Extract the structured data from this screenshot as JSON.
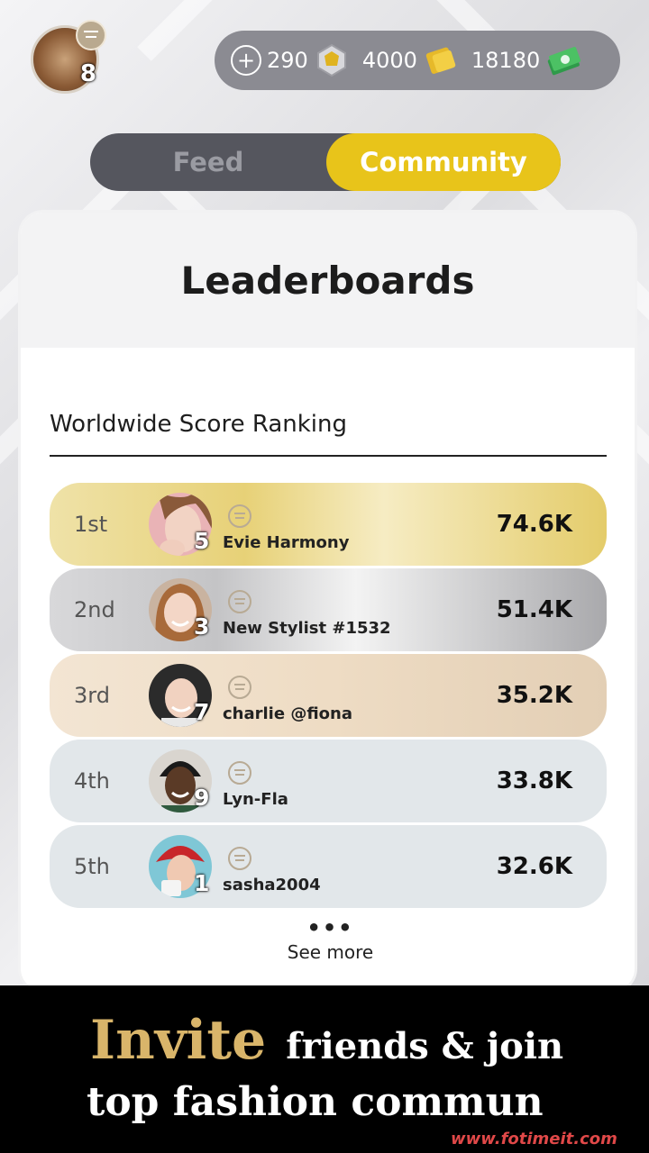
{
  "header": {
    "player_level": "8",
    "currencies": [
      {
        "icon": "gem-coin-icon",
        "value": "290"
      },
      {
        "icon": "gold-ticket-icon",
        "value": "4000"
      },
      {
        "icon": "cash-stack-icon",
        "value": "18180"
      }
    ],
    "add_symbol": "+"
  },
  "tabs": [
    {
      "label": "Feed",
      "active": false
    },
    {
      "label": "Community",
      "active": true
    }
  ],
  "card": {
    "title": "Leaderboards",
    "section_title": "Worldwide Score Ranking",
    "rows": [
      {
        "rank": "1st",
        "level": "5",
        "name": "Evie Harmony",
        "score": "74.6K"
      },
      {
        "rank": "2nd",
        "level": "3",
        "name": "New Stylist #1532",
        "score": "51.4K"
      },
      {
        "rank": "3rd",
        "level": "7",
        "name": "charlie @fiona",
        "score": "35.2K"
      },
      {
        "rank": "4th",
        "level": "9",
        "name": "Lyn-Fla",
        "score": "33.8K"
      },
      {
        "rank": "5th",
        "level": "1",
        "name": "sasha2004",
        "score": "32.6K"
      }
    ],
    "see_more_dots": "•••",
    "see_more": "See more"
  },
  "banner": {
    "word1": "Invite",
    "line1_rest": "friends & join",
    "line2": "top fashion commun",
    "watermark": "www.fotimeit.com"
  },
  "colors": {
    "accent_yellow": "#e8c41a",
    "tab_bg": "#55565e",
    "currency_bg": "#8b8b92",
    "gold_text": "#d9b56a"
  }
}
